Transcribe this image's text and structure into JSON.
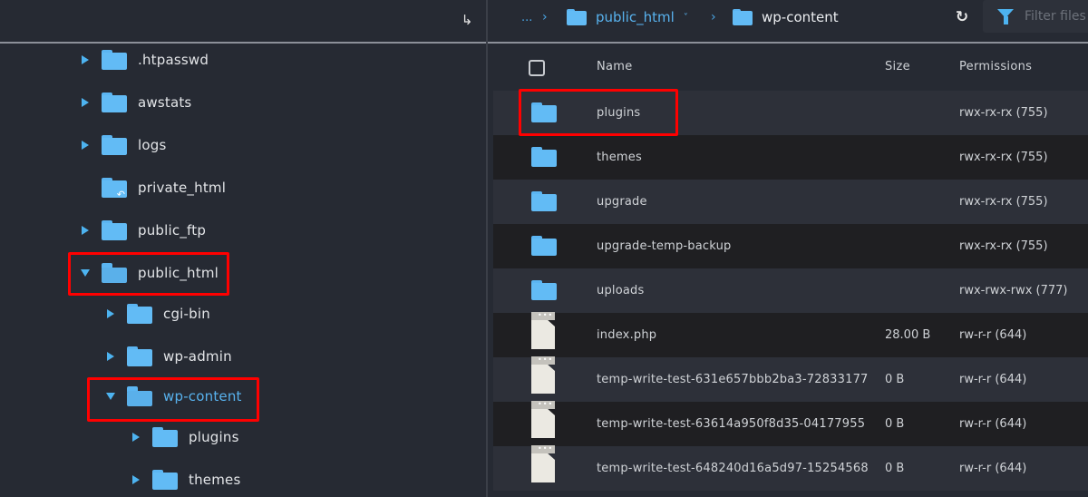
{
  "tree": {
    "collapse_icon": "↳",
    "items": [
      {
        "label": ".htpasswd",
        "state": "collapsed",
        "level": 0,
        "icon": "folder-icon"
      },
      {
        "label": "awstats",
        "state": "collapsed",
        "level": 0,
        "icon": "folder-icon"
      },
      {
        "label": "logs",
        "state": "collapsed",
        "level": 0,
        "icon": "folder-icon"
      },
      {
        "label": "private_html",
        "state": "none",
        "level": 0,
        "icon": "folder-link-icon"
      },
      {
        "label": "public_ftp",
        "state": "collapsed",
        "level": 0,
        "icon": "folder-icon"
      },
      {
        "label": "public_html",
        "state": "expanded",
        "level": 0,
        "icon": "folder-open-icon",
        "highlighted": true
      },
      {
        "label": "cgi-bin",
        "state": "collapsed",
        "level": 1,
        "icon": "folder-icon"
      },
      {
        "label": "wp-admin",
        "state": "collapsed",
        "level": 1,
        "icon": "folder-icon"
      },
      {
        "label": "wp-content",
        "state": "expanded",
        "level": 1,
        "icon": "folder-open-icon",
        "active": true,
        "highlighted": true
      },
      {
        "label": "plugins",
        "state": "collapsed",
        "level": 2,
        "icon": "folder-icon"
      },
      {
        "label": "themes",
        "state": "collapsed",
        "level": 2,
        "icon": "folder-icon"
      }
    ]
  },
  "breadcrumb": {
    "ellipsis": "...",
    "separator": "›",
    "parent": "public_html",
    "parent_dropdown": "˅",
    "current": "wp-content"
  },
  "toolbar": {
    "refresh_icon": "↻",
    "filter_placeholder": "Filter files"
  },
  "table": {
    "columns": {
      "name": "Name",
      "size": "Size",
      "permissions": "Permissions"
    },
    "rows": [
      {
        "type": "folder",
        "name": "plugins",
        "size": "",
        "permissions": "rwx-rx-rx (755)",
        "highlighted": true
      },
      {
        "type": "folder",
        "name": "themes",
        "size": "",
        "permissions": "rwx-rx-rx (755)"
      },
      {
        "type": "folder",
        "name": "upgrade",
        "size": "",
        "permissions": "rwx-rx-rx (755)"
      },
      {
        "type": "folder",
        "name": "upgrade-temp-backup",
        "size": "",
        "permissions": "rwx-rx-rx (755)"
      },
      {
        "type": "folder",
        "name": "uploads",
        "size": "",
        "permissions": "rwx-rwx-rwx (777)"
      },
      {
        "type": "file",
        "name": "index.php",
        "size": "28.00 B",
        "permissions": "rw-r-r (644)"
      },
      {
        "type": "file",
        "name": "temp-write-test-631e657bbb2ba3-72833177",
        "size": "0 B",
        "permissions": "rw-r-r (644)"
      },
      {
        "type": "file",
        "name": "temp-write-test-63614a950f8d35-04177955",
        "size": "0 B",
        "permissions": "rw-r-r (644)"
      },
      {
        "type": "file",
        "name": "temp-write-test-648240d16a5d97-15254568",
        "size": "0 B",
        "permissions": "rw-r-r (644)"
      }
    ]
  },
  "colors": {
    "accent": "#4db3f0",
    "folder": "#62bbf5",
    "highlight": "#ff0000",
    "background": "#262a33"
  }
}
